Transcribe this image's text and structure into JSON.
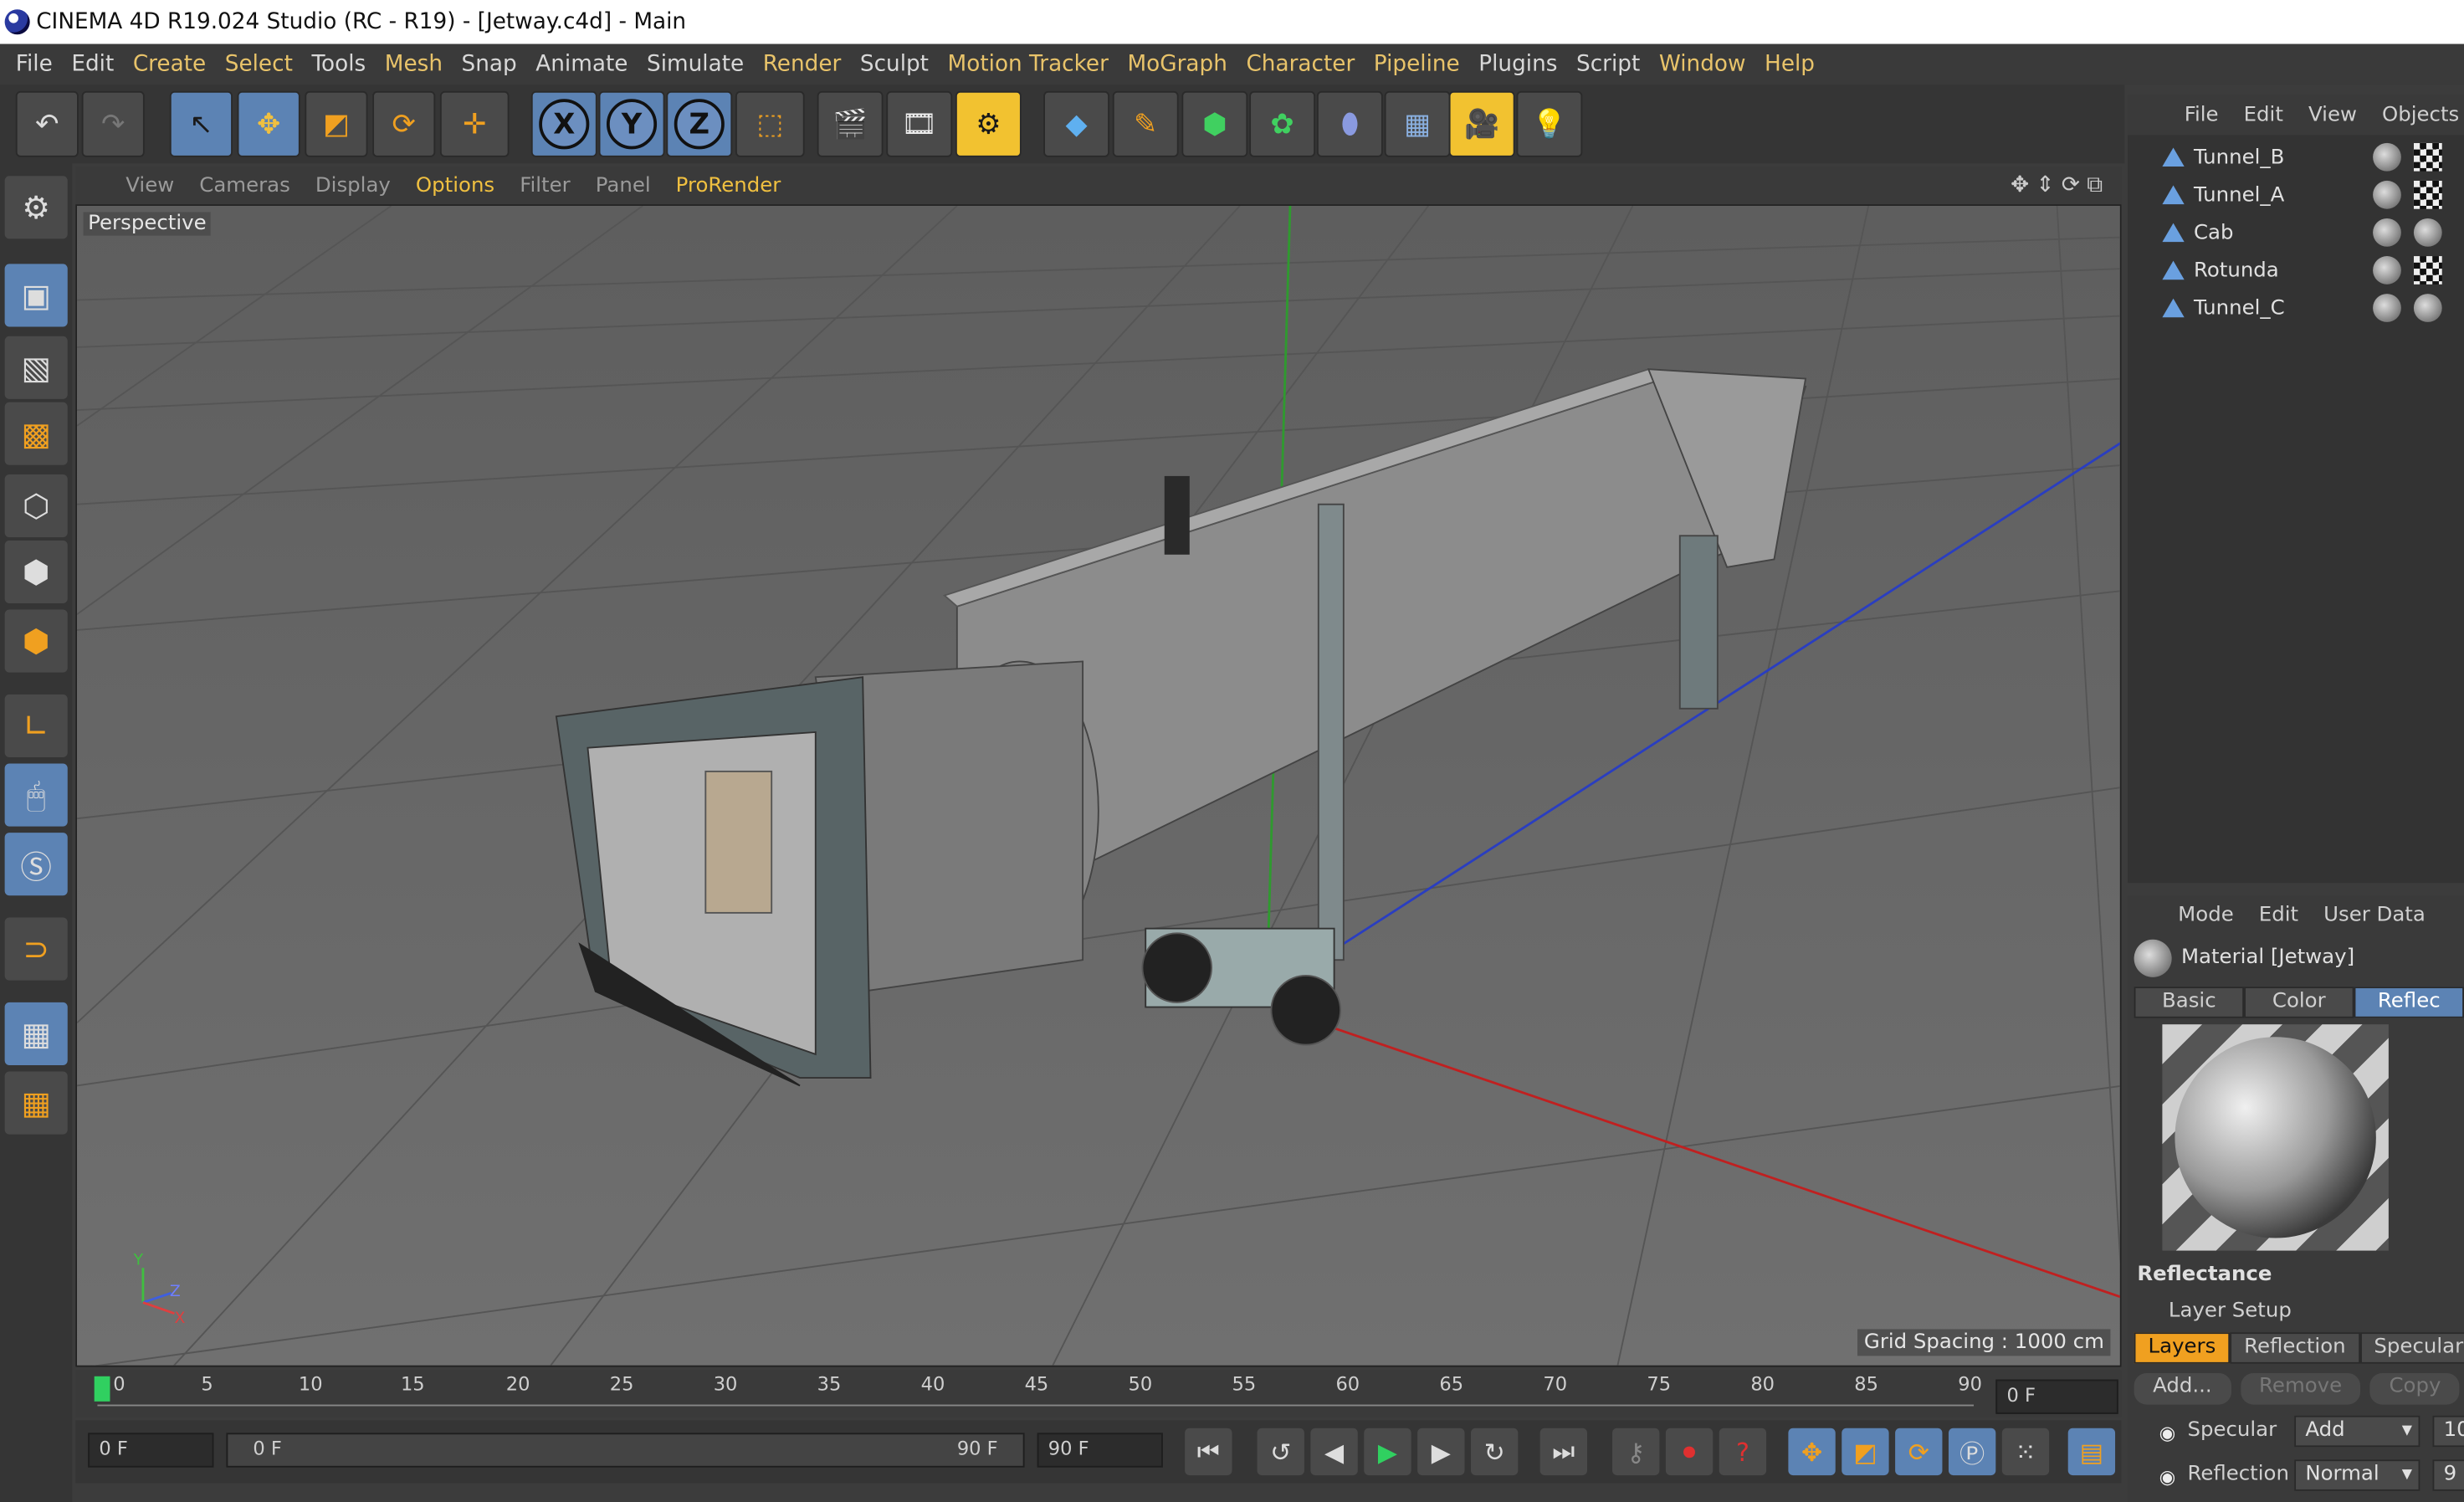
{
  "window": {
    "title": "CINEMA 4D R19.024 Studio (RC - R19) - [Jetway.c4d] - Main"
  },
  "menu": [
    "File",
    "Edit",
    "Create",
    "Select",
    "Tools",
    "Mesh",
    "Snap",
    "Animate",
    "Simulate",
    "Render",
    "Sculpt",
    "Motion Tracker",
    "MoGraph",
    "Character",
    "Pipeline",
    "Plugins",
    "Script",
    "Window",
    "Help"
  ],
  "toolbar": {
    "icons": [
      "undo-icon",
      "redo-icon",
      "select-icon",
      "move-icon",
      "scale-icon",
      "rotate-icon",
      "transform-icon",
      "x-axis-icon",
      "y-axis-icon",
      "z-axis-icon",
      "coordinate-system-icon",
      "render-view-icon",
      "render-picture-icon",
      "render-settings-icon",
      "cube-icon",
      "pen-icon",
      "subdivision-icon",
      "cloner-icon",
      "deformer-icon",
      "floor-icon",
      "camera-icon",
      "light-icon"
    ],
    "axis": {
      "x": "X",
      "y": "Y",
      "z": "Z"
    }
  },
  "viewport": {
    "menu": [
      "View",
      "Cameras",
      "Display",
      "Options",
      "Filter",
      "Panel",
      "ProRender"
    ],
    "label": "Perspective",
    "grid_spacing": "Grid Spacing : 1000 cm",
    "axis_gizmo": {
      "y": "Y",
      "z": "Z",
      "x": "X"
    }
  },
  "timeline": {
    "ticks": [
      "0",
      "5",
      "10",
      "15",
      "20",
      "25",
      "30",
      "35",
      "40",
      "45",
      "50",
      "55",
      "60",
      "65",
      "70",
      "75",
      "80",
      "85",
      "90"
    ],
    "current_frame": "0 F",
    "start_frame": "0 F",
    "range_start": "0 F",
    "range_end": "90 F",
    "end_frame": "90 F"
  },
  "objects": {
    "menu": [
      "File",
      "Edit",
      "View",
      "Objects"
    ],
    "items": [
      {
        "name": "Tunnel_B"
      },
      {
        "name": "Tunnel_A"
      },
      {
        "name": "Cab"
      },
      {
        "name": "Rotunda"
      },
      {
        "name": "Tunnel_C"
      }
    ]
  },
  "attributes": {
    "menu": [
      "Mode",
      "Edit",
      "User Data"
    ],
    "material_title": "Material [Jetway]",
    "tabs": [
      "Basic",
      "Color",
      "Reflec"
    ],
    "section": "Reflectance",
    "layer_setup": "Layer Setup",
    "layer_tabs": [
      "Layers",
      "Reflection",
      "Specular"
    ],
    "buttons": [
      "Add...",
      "Remove",
      "Copy"
    ],
    "rows": [
      {
        "label": "Specular",
        "mode": "Add",
        "value": "10"
      },
      {
        "label": "Reflection",
        "mode": "Normal",
        "value": "9"
      }
    ]
  },
  "colors": {
    "accent_blue": "#5c83b4",
    "accent_yellow": "#f0c040",
    "active_orange": "#f0a020"
  }
}
